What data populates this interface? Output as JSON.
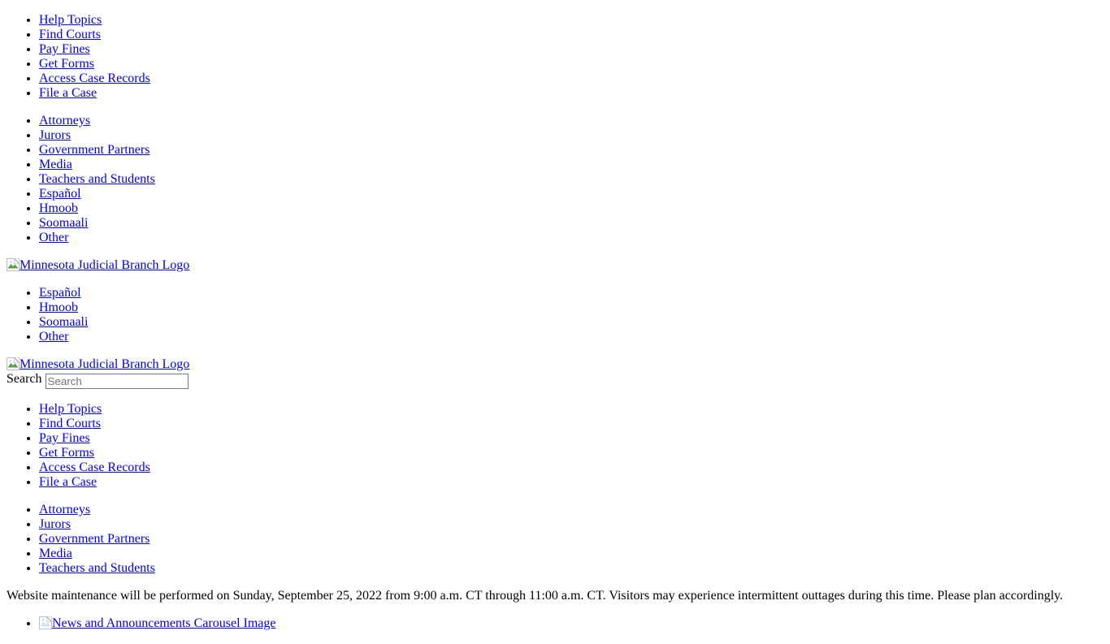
{
  "page": {
    "background": "#ffffff",
    "link_color": "#0000EE",
    "text_color": "#000000"
  },
  "top_nav": {
    "primary_items": [
      {
        "label": "Help Topics"
      },
      {
        "label": "Find Courts"
      },
      {
        "label": "Pay Fines"
      },
      {
        "label": "Get Forms"
      },
      {
        "label": "Access Case Records"
      },
      {
        "label": "File a Case"
      }
    ],
    "audience_items": [
      {
        "label": "Attorneys"
      },
      {
        "label": "Jurors"
      },
      {
        "label": "Government Partners"
      },
      {
        "label": "Media"
      },
      {
        "label": "Teachers and Students"
      },
      {
        "label": "Español"
      },
      {
        "label": "Hmoob"
      },
      {
        "label": "Soomaali"
      },
      {
        "label": "Other"
      }
    ]
  },
  "logo_primary": {
    "icon": "broken-image-icon",
    "alt_text": "Minnesota Judicial Branch Logo"
  },
  "language_nav": {
    "items": [
      {
        "label": "Español"
      },
      {
        "label": "Hmoob"
      },
      {
        "label": "Soomaali"
      },
      {
        "label": "Other"
      }
    ]
  },
  "logo_secondary": {
    "icon": "broken-image-icon",
    "alt_text": "Minnesota Judicial Branch Logo"
  },
  "search": {
    "label": "Search",
    "placeholder": "Search",
    "value": ""
  },
  "main_nav": {
    "primary_items": [
      {
        "label": "Help Topics"
      },
      {
        "label": "Find Courts"
      },
      {
        "label": "Pay Fines"
      },
      {
        "label": "Get Forms"
      },
      {
        "label": "Access Case Records"
      },
      {
        "label": "File a Case"
      }
    ],
    "audience_items": [
      {
        "label": "Attorneys"
      },
      {
        "label": "Jurors"
      },
      {
        "label": "Government Partners"
      },
      {
        "label": "Media"
      },
      {
        "label": "Teachers and Students"
      }
    ]
  },
  "maintenance_notice": {
    "text": "Website maintenance will be performed on Sunday, September 25, 2022 from 9:00 a.m. CT through 11:00 a.m. CT. Visitors may experience intermittent outtages during this time. Please plan accordingly."
  },
  "carousel": {
    "items": [
      {
        "icon": "broken-image-icon",
        "alt_text": "News and Announcements Carousel Image"
      }
    ]
  }
}
